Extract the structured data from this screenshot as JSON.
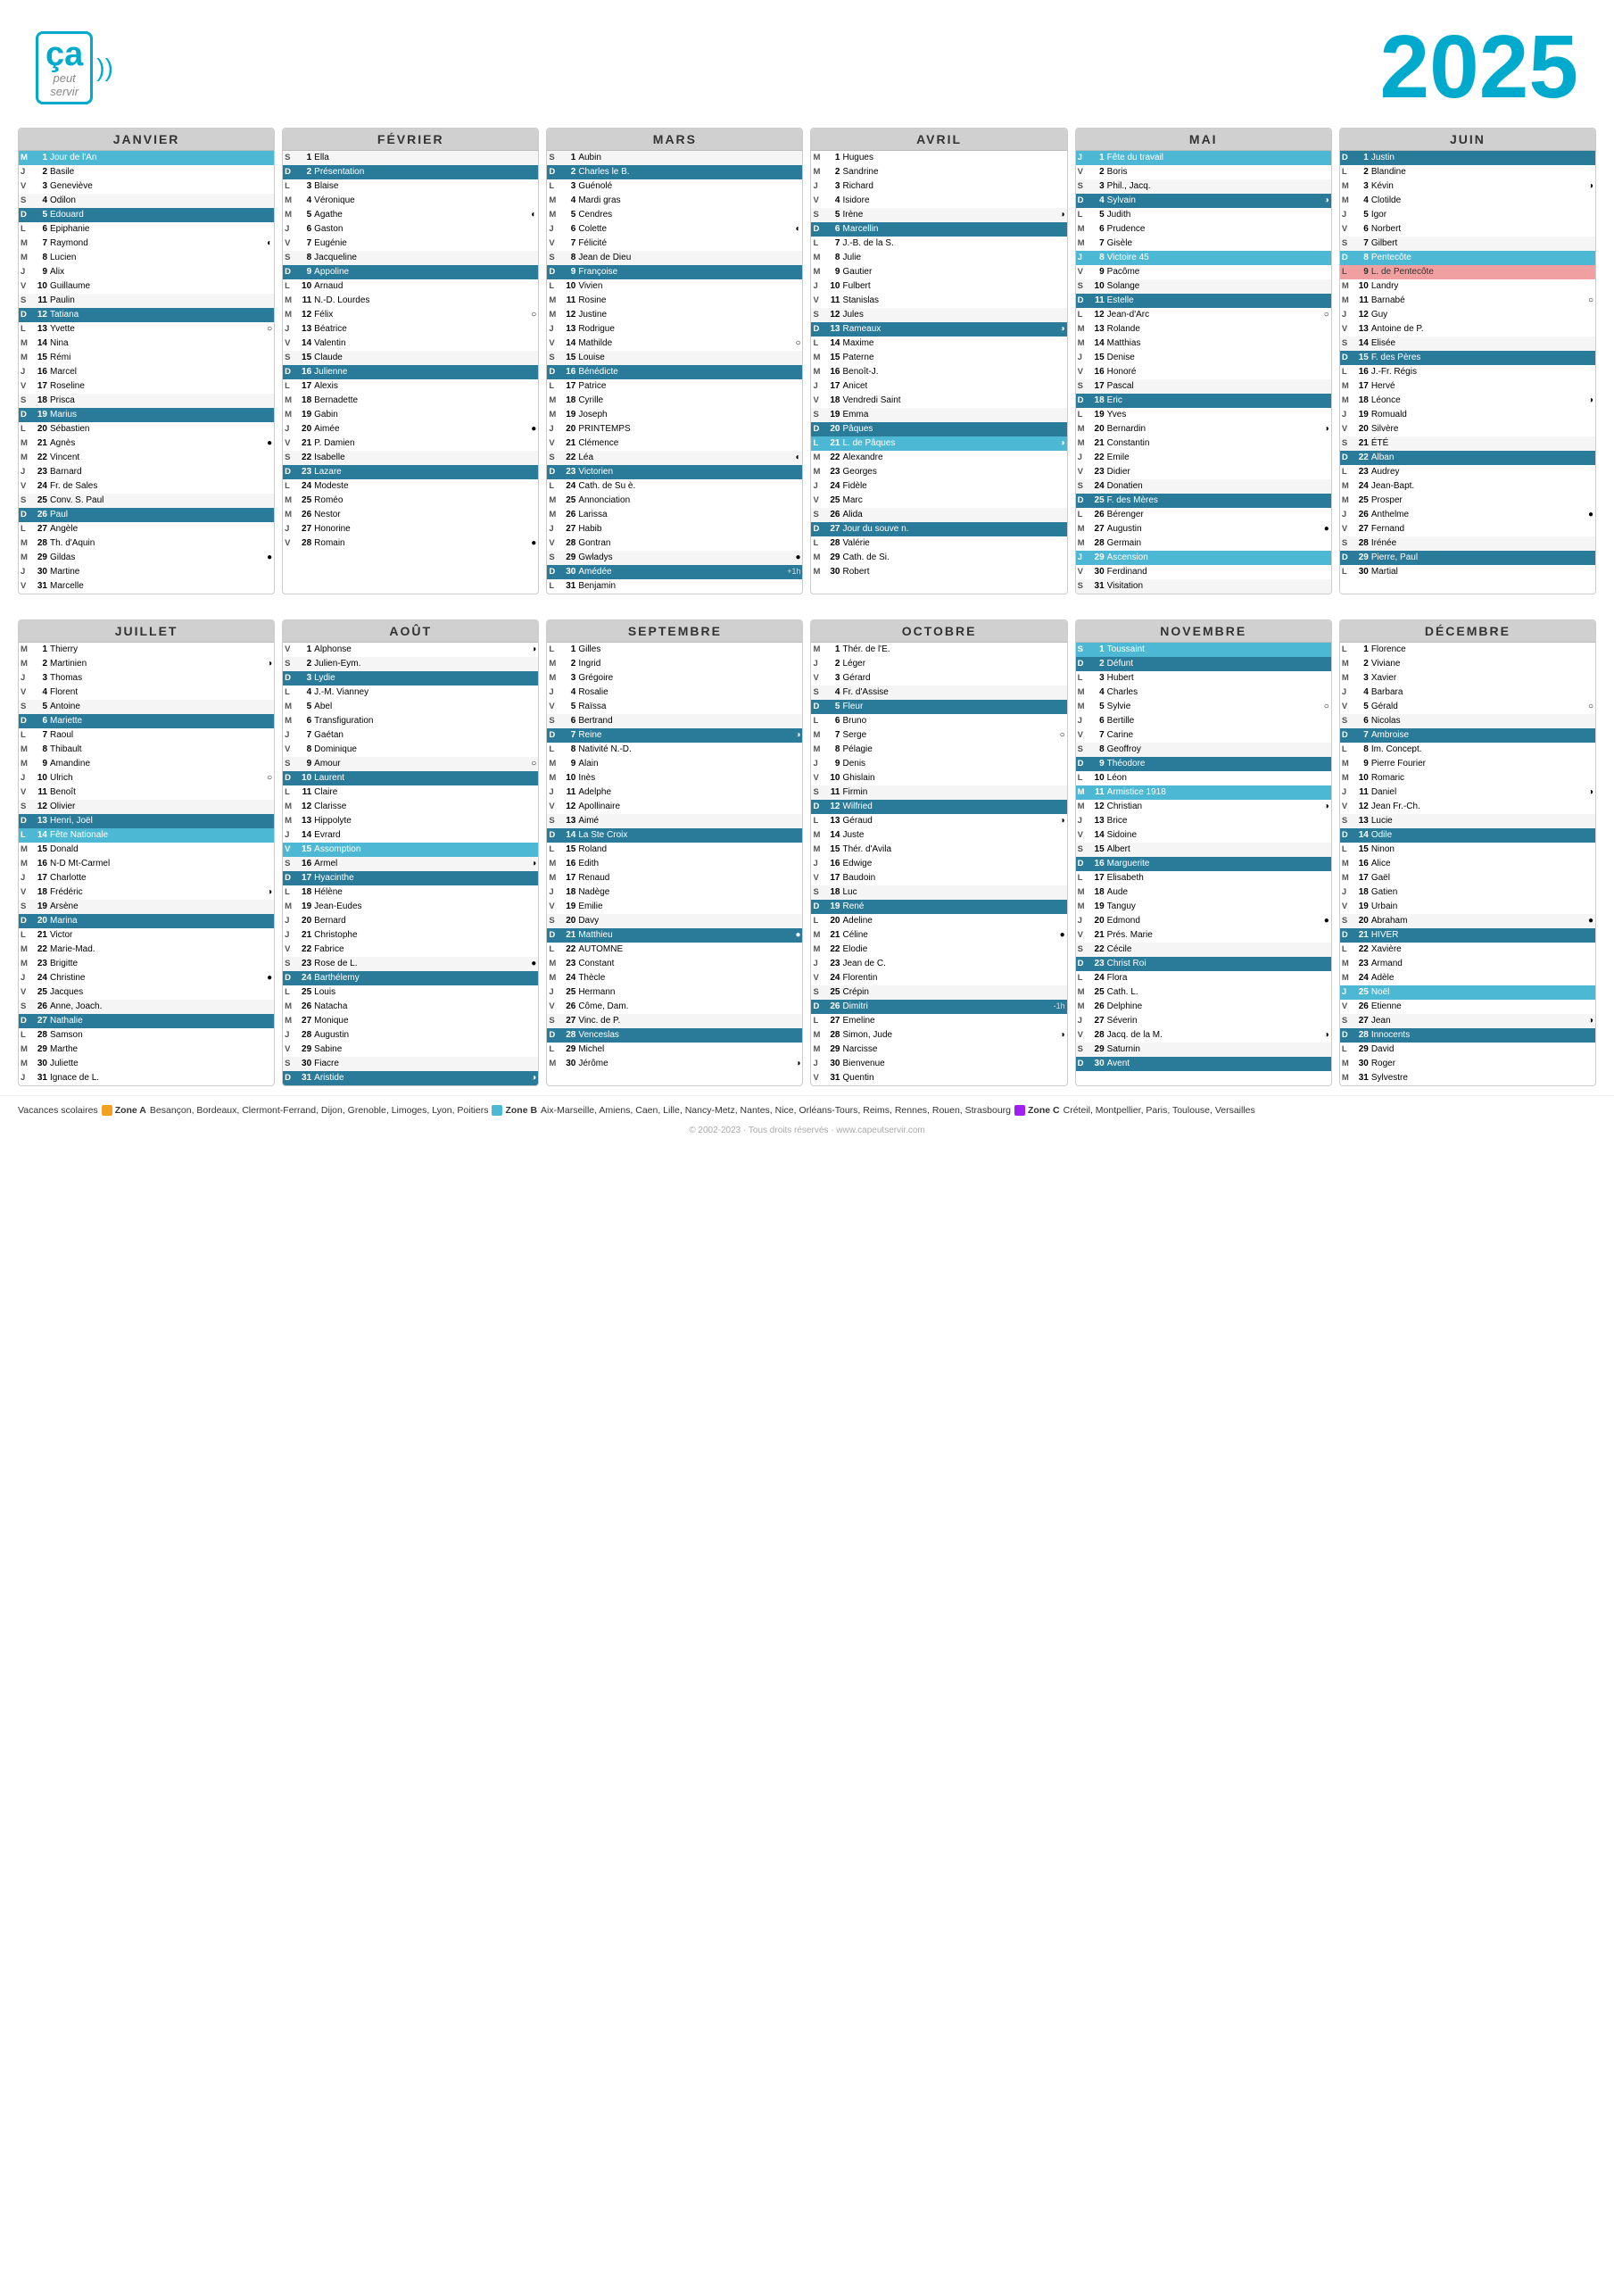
{
  "header": {
    "logo_ca": "ça",
    "logo_peut": "peut",
    "logo_servir": "servir",
    "year": "2025",
    "waves": "))"
  },
  "footer": {
    "legend_text": "Vacances scolaires  Zone A  Besançon, Bordeaux, Clermont-Ferrand, Dijon, Grenoble, Limoges, Lyon, Poitiers  Zone B  Aix-Marseille, Amiens, Caen, Lille, Nancy-Metz, Nantes, Nice, Orléans-Tours, Reims, Rennes, Rouen, Strasbourg  Zone C  Créteil, Montpellier, Paris, Toulouse, Versailles",
    "copyright": "© 2002-2023 · Tous droits réservés · www.capeutservir.com"
  },
  "months": [
    {
      "name": "JANVIER",
      "abbrev": "JANVIER"
    },
    {
      "name": "FÉVRIER",
      "abbrev": "FÉVRIER"
    },
    {
      "name": "MARS",
      "abbrev": "MARS"
    },
    {
      "name": "AVRIL",
      "abbrev": "AVRIL"
    },
    {
      "name": "MAI",
      "abbrev": "MAI"
    },
    {
      "name": "JUIN",
      "abbrev": "JUIN"
    },
    {
      "name": "JUILLET",
      "abbrev": "JUILLET"
    },
    {
      "name": "AOÛT",
      "abbrev": "AOÛT"
    },
    {
      "name": "SEPTEMBRE",
      "abbrev": "SEPTEMBRE"
    },
    {
      "name": "OCTOBRE",
      "abbrev": "OCTOBRE"
    },
    {
      "name": "NOVEMBRE",
      "abbrev": "NOVEMBRE"
    },
    {
      "name": "DÉCEMBRE",
      "abbrev": "DÉCEMBRE"
    }
  ]
}
